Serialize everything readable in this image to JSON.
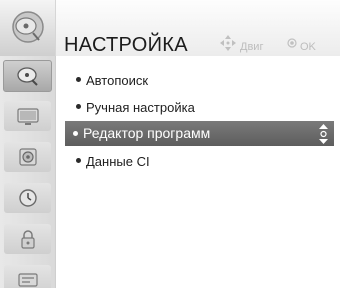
{
  "header": {
    "title": "НАСТРОЙКА",
    "hints": [
      {
        "icon": "move-arrows-icon",
        "label": "Двиг"
      },
      {
        "icon": "ok-icon",
        "label": "OK"
      }
    ]
  },
  "sidebar": {
    "categories": [
      {
        "icon": "setup-satellite-icon",
        "active": true
      },
      {
        "icon": "picture-icon",
        "active": false
      },
      {
        "icon": "audio-icon",
        "active": false
      },
      {
        "icon": "time-icon",
        "active": false
      },
      {
        "icon": "lock-icon",
        "active": false
      },
      {
        "icon": "option-icon",
        "active": false
      }
    ]
  },
  "menu": {
    "items": [
      {
        "label": "Автопоиск",
        "selected": false
      },
      {
        "label": "Ручная настройка",
        "selected": false
      },
      {
        "label": "Редактор программ",
        "selected": true
      },
      {
        "label": "Данные CI",
        "selected": false
      }
    ]
  },
  "colors": {
    "selection": "#6b6b6b",
    "hint_text": "#bdbdbd",
    "text": "#1e1e1e"
  }
}
